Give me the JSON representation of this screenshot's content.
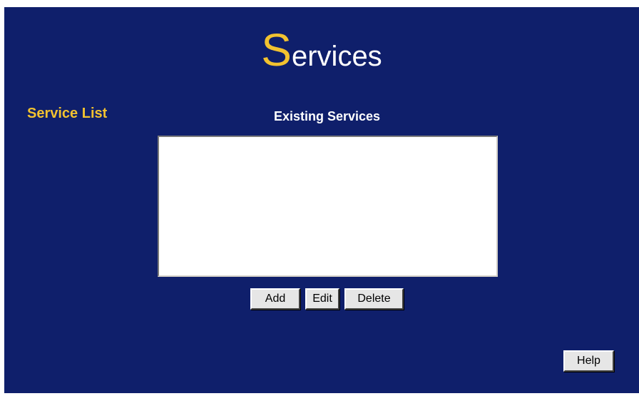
{
  "page": {
    "title_initial": "S",
    "title_rest": "ervices",
    "section_label": "Service List",
    "list_heading": "Existing Services"
  },
  "services_list": {
    "items": []
  },
  "buttons": {
    "add": "Add",
    "edit": "Edit",
    "delete": "Delete",
    "help": "Help"
  },
  "colors": {
    "background": "#0f1f6b",
    "accent": "#f2c230"
  }
}
